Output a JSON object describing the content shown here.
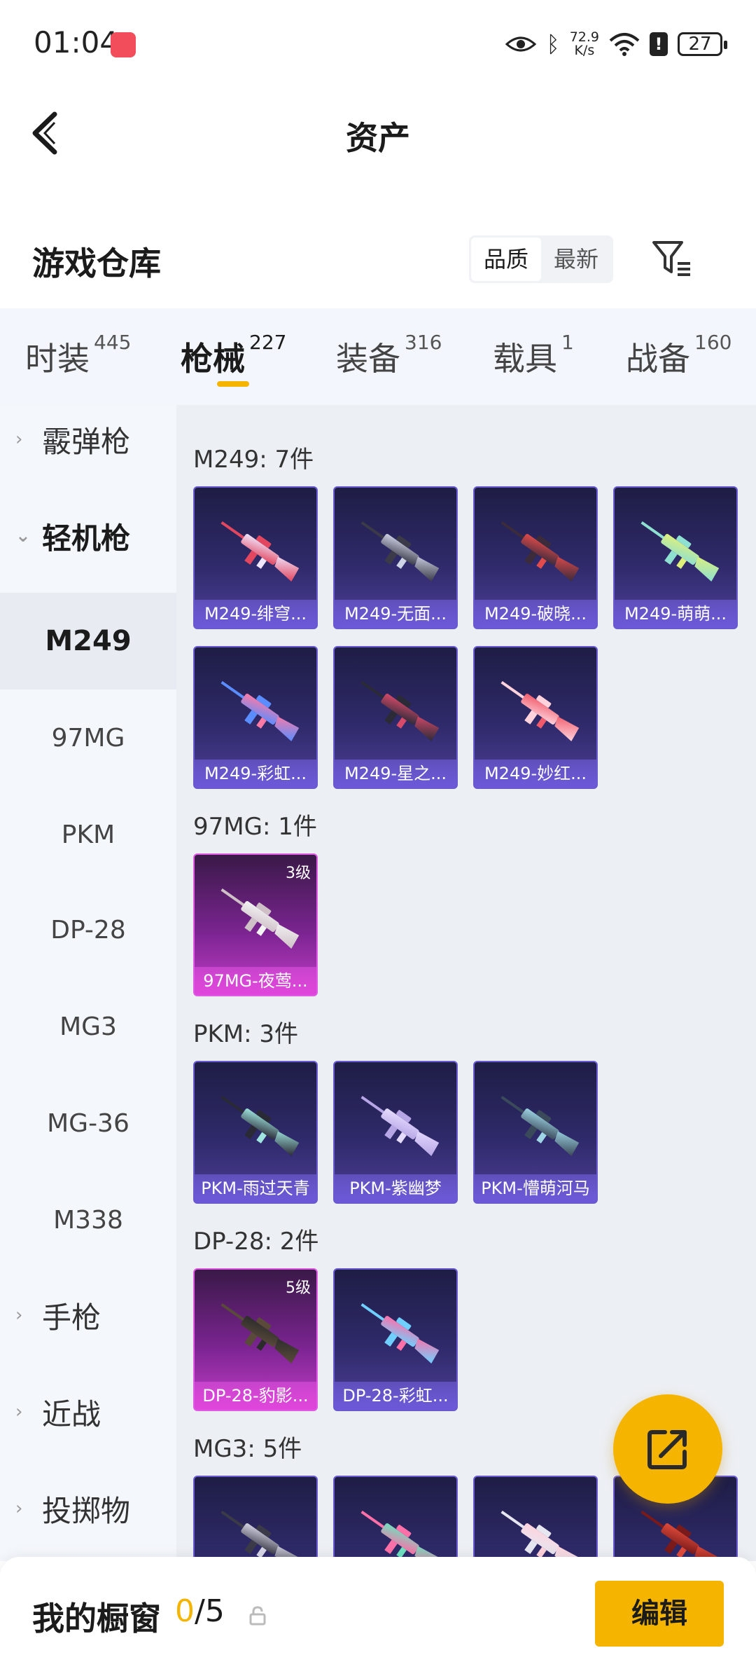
{
  "status_bar": {
    "time": "01:04",
    "net_speed_value": "72.9",
    "net_speed_unit": "K/s",
    "battery": "27"
  },
  "header": {
    "title": "资产"
  },
  "warehouse": {
    "title": "游戏仓库",
    "sort_options": [
      "品质",
      "最新"
    ],
    "sort_selected": "品质"
  },
  "tabs": [
    {
      "label": "时装",
      "count": "445",
      "active": false
    },
    {
      "label": "枪械",
      "count": "227",
      "active": true
    },
    {
      "label": "装备",
      "count": "316",
      "active": false
    },
    {
      "label": "载具",
      "count": "1",
      "active": false
    },
    {
      "label": "战备",
      "count": "160",
      "active": false
    }
  ],
  "sidebar": {
    "groups": [
      {
        "label": "霰弹枪",
        "expanded": false
      },
      {
        "label": "轻机枪",
        "expanded": true
      },
      {
        "label": "手枪",
        "expanded": false
      },
      {
        "label": "近战",
        "expanded": false
      },
      {
        "label": "投掷物",
        "expanded": false
      }
    ],
    "items": [
      "M249",
      "97MG",
      "PKM",
      "DP-28",
      "MG3",
      "MG-36",
      "M338"
    ],
    "selected_item": "M249"
  },
  "sections": [
    {
      "heading": "M249: 7件",
      "items": [
        {
          "name": "M249-绯穹...",
          "level": "",
          "rarity": "purple",
          "colors": [
            "#f0e6ff",
            "#e2475f"
          ]
        },
        {
          "name": "M249-无面...",
          "level": "",
          "rarity": "purple",
          "colors": [
            "#cfd3e6",
            "#3a3a48"
          ]
        },
        {
          "name": "M249-破晓...",
          "level": "",
          "rarity": "purple",
          "colors": [
            "#e14b4b",
            "#3b2b3b"
          ]
        },
        {
          "name": "M249-萌萌...",
          "level": "",
          "rarity": "purple",
          "colors": [
            "#dff07a",
            "#8ee0d0"
          ]
        },
        {
          "name": "M249-彩虹...",
          "level": "",
          "rarity": "purple",
          "colors": [
            "#ff7aa5",
            "#5a8dff"
          ]
        },
        {
          "name": "M249-星之...",
          "level": "",
          "rarity": "purple",
          "colors": [
            "#d84a6a",
            "#2b2b38"
          ]
        },
        {
          "name": "M249-妙红...",
          "level": "",
          "rarity": "purple",
          "colors": [
            "#f05a6a",
            "#ffd2dc"
          ]
        }
      ]
    },
    {
      "heading": "97MG: 1件",
      "items": [
        {
          "name": "97MG-夜莺...",
          "level": "3级",
          "rarity": "pink",
          "colors": [
            "#f4f4f4",
            "#cfc0c8"
          ]
        }
      ]
    },
    {
      "heading": "PKM: 3件",
      "items": [
        {
          "name": "PKM-雨过天青",
          "level": "",
          "rarity": "purple",
          "colors": [
            "#9fe6e0",
            "#2a2a36"
          ]
        },
        {
          "name": "PKM-紫幽梦",
          "level": "",
          "rarity": "purple",
          "colors": [
            "#e6dcff",
            "#b7a6e6"
          ]
        },
        {
          "name": "PKM-懵萌河马",
          "level": "",
          "rarity": "purple",
          "colors": [
            "#9fd6e6",
            "#3a4a5a"
          ]
        }
      ]
    },
    {
      "heading": "DP-28: 2件",
      "items": [
        {
          "name": "DP-28-豹影...",
          "level": "5级",
          "rarity": "pink",
          "colors": [
            "#2b2b2b",
            "#5a4a3a"
          ]
        },
        {
          "name": "DP-28-彩虹...",
          "level": "",
          "rarity": "purple",
          "colors": [
            "#ff6fa8",
            "#6fd0ff"
          ]
        }
      ]
    },
    {
      "heading": "MG3: 5件",
      "items": [
        {
          "name": "",
          "level": "",
          "rarity": "purple",
          "colors": [
            "#d6d6e6",
            "#3a3a48"
          ]
        },
        {
          "name": "",
          "level": "",
          "rarity": "purple",
          "colors": [
            "#6fe0c0",
            "#ff6fa8"
          ]
        },
        {
          "name": "",
          "level": "",
          "rarity": "purple",
          "colors": [
            "#ffd2dc",
            "#e6e6f0"
          ]
        },
        {
          "name": "",
          "level": "",
          "rarity": "purple",
          "colors": [
            "#e14b3b",
            "#7a1a1a"
          ]
        }
      ]
    }
  ],
  "bottom_bar": {
    "label": "我的橱窗",
    "current": "0",
    "total": "/5",
    "edit_label": "编辑"
  },
  "colors": {
    "accent": "#f5b400",
    "card_purple": "#2f2a6a",
    "card_pink": "#c43cc8"
  },
  "icons": [
    "back-arrow-icon",
    "filter-icon",
    "share-external-icon",
    "lock-icon",
    "eye-icon",
    "bluetooth-icon",
    "wifi-icon",
    "alert-icon",
    "battery-icon"
  ]
}
